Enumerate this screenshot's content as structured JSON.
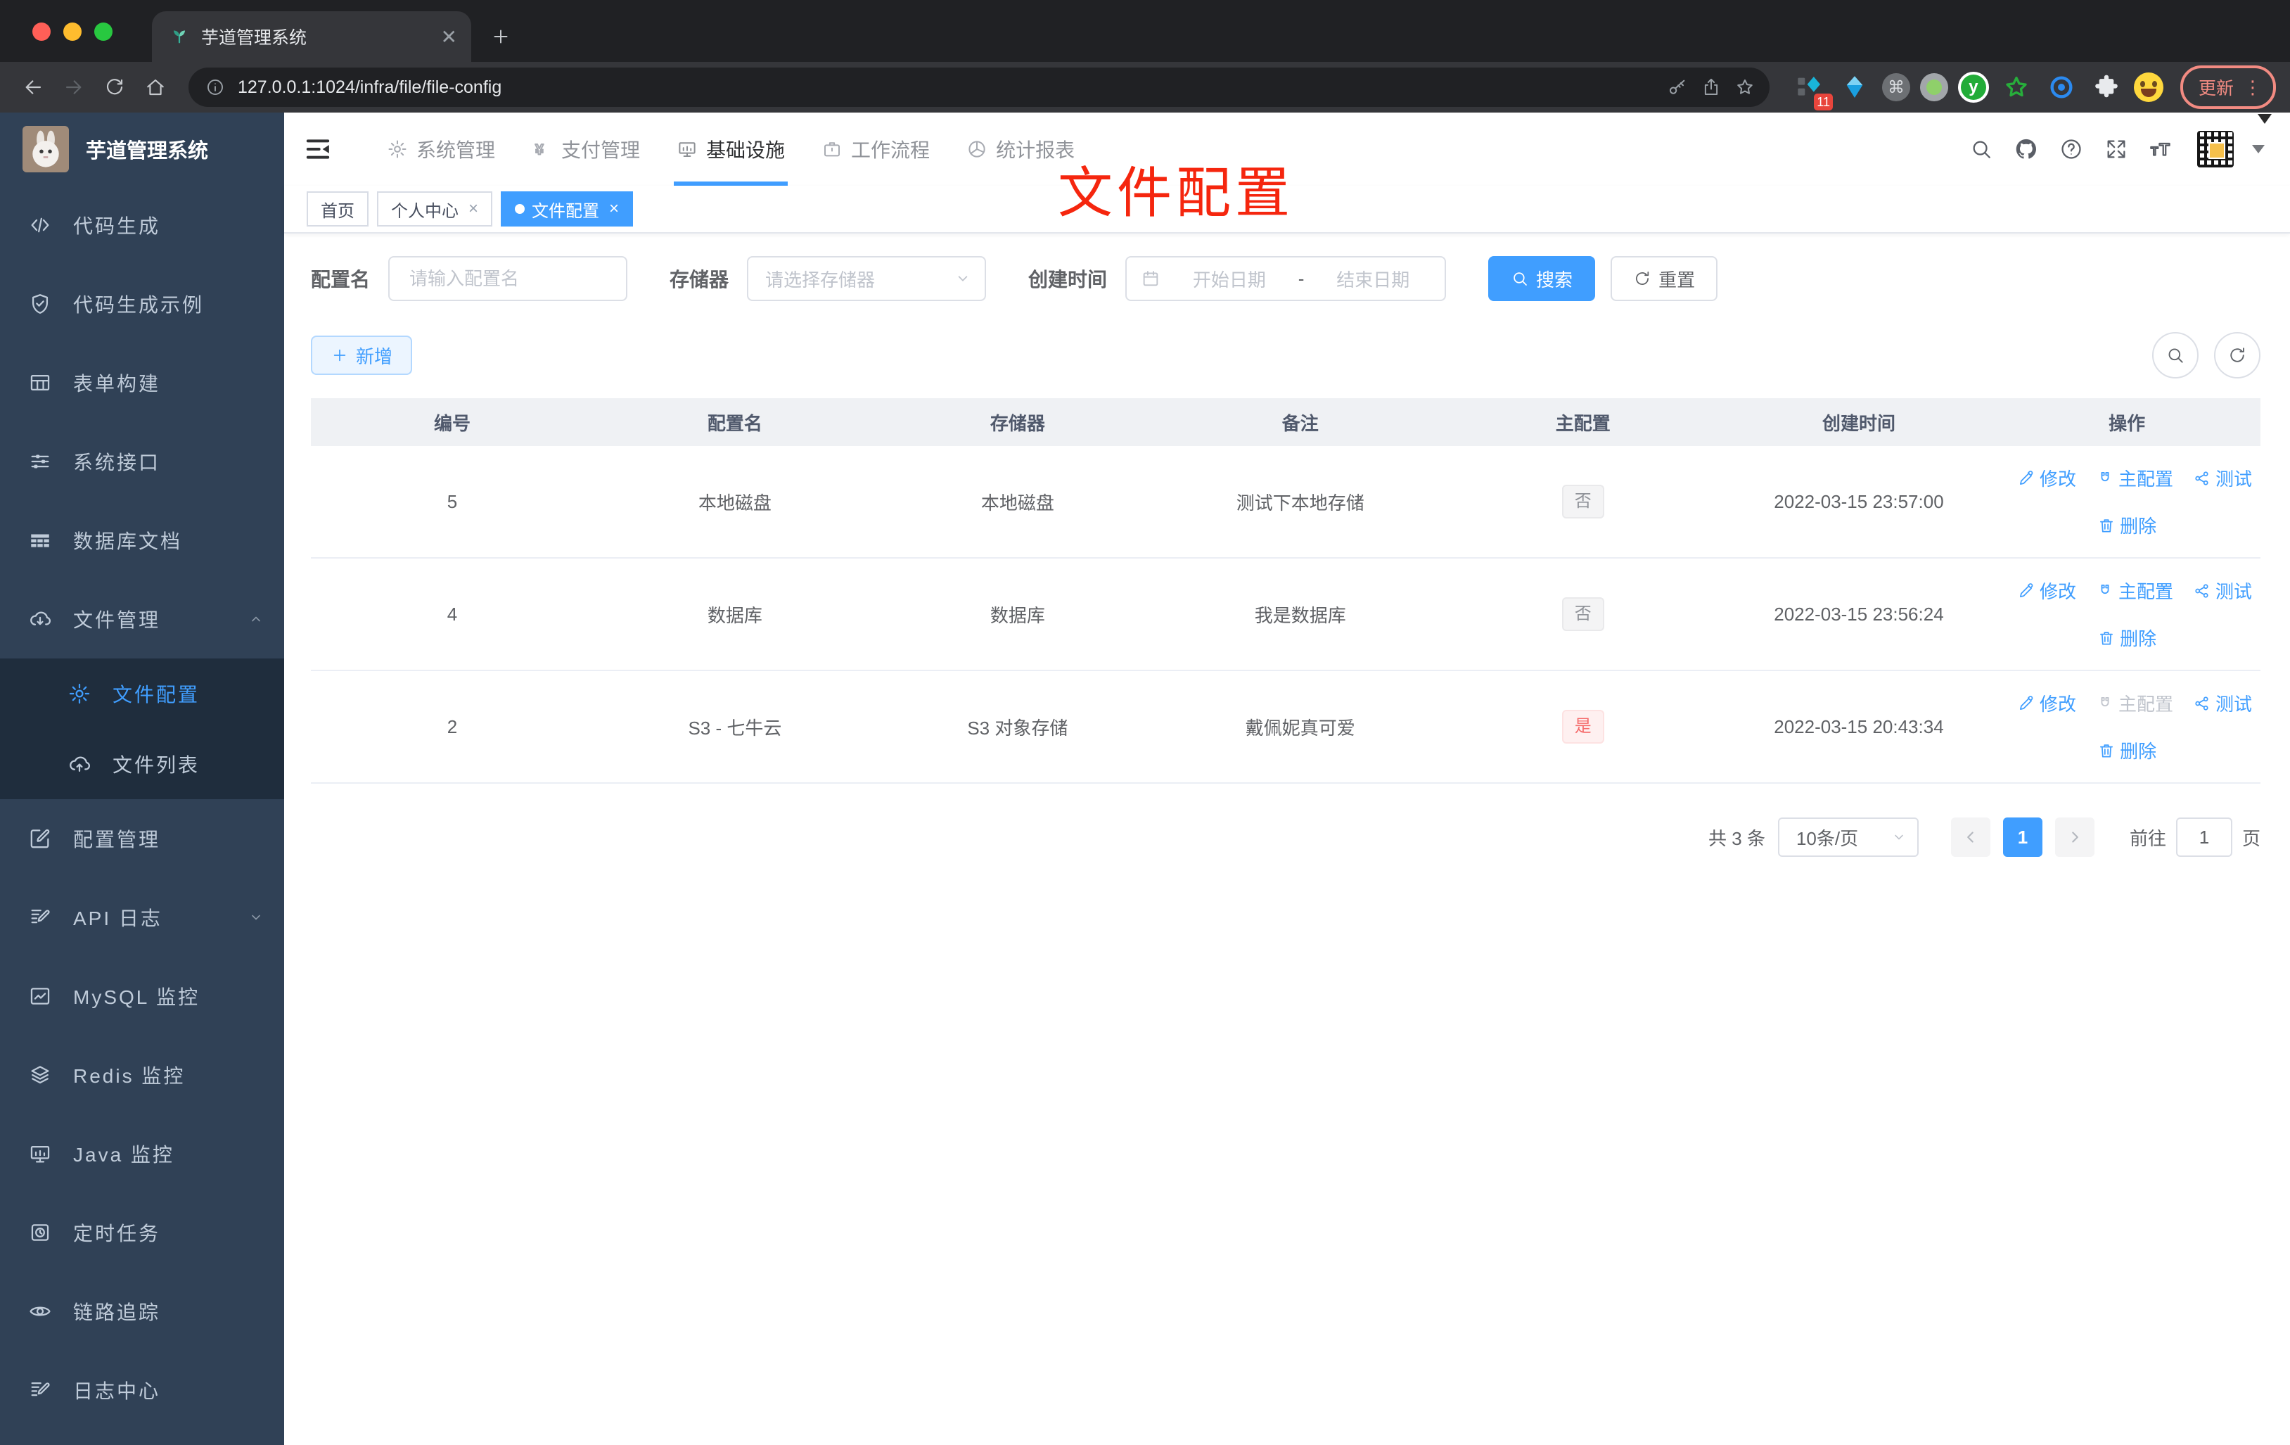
{
  "browser": {
    "tab_title": "芋道管理系统",
    "url": "127.0.0.1:1024/infra/file/file-config",
    "update_label": "更新",
    "extension_badge": "11"
  },
  "annotation": {
    "text": "文件配置"
  },
  "colors": {
    "primary": "#409eff",
    "danger": "#f56c6c",
    "annotation": "#f5260e",
    "sidebar_bg": "#304156",
    "submenu_bg": "#1f2d3d"
  },
  "sidebar": {
    "title": "芋道管理系统",
    "items": [
      {
        "key": "code-generation",
        "label": "代码生成",
        "icon": "code"
      },
      {
        "key": "code-example",
        "label": "代码生成示例",
        "icon": "shield"
      },
      {
        "key": "form-builder",
        "label": "表单构建",
        "icon": "form"
      },
      {
        "key": "system-api",
        "label": "系统接口",
        "icon": "sliders"
      },
      {
        "key": "db-doc",
        "label": "数据库文档",
        "icon": "tableS"
      },
      {
        "key": "file-manage",
        "label": "文件管理",
        "icon": "cloud-down",
        "chevron": "up"
      },
      {
        "key": "file-config",
        "label": "文件配置",
        "icon": "gear",
        "level": 2,
        "active": true
      },
      {
        "key": "file-list",
        "label": "文件列表",
        "icon": "cloud-up",
        "level": 2
      },
      {
        "key": "config-manage",
        "label": "配置管理",
        "icon": "edit"
      },
      {
        "key": "api-log",
        "label": "API 日志",
        "icon": "doc",
        "chevron": "down"
      },
      {
        "key": "mysql-monitor",
        "label": "MySQL 监控",
        "icon": "chart"
      },
      {
        "key": "redis-monitor",
        "label": "Redis 监控",
        "icon": "layers"
      },
      {
        "key": "java-monitor",
        "label": "Java 监控",
        "icon": "monitor"
      },
      {
        "key": "scheduled-task",
        "label": "定时任务",
        "icon": "clock"
      },
      {
        "key": "trace",
        "label": "链路追踪",
        "icon": "eye"
      },
      {
        "key": "log-center",
        "label": "日志中心",
        "icon": "doc"
      }
    ]
  },
  "topnav": {
    "items": [
      {
        "key": "system",
        "label": "系统管理",
        "icon": "gear"
      },
      {
        "key": "payment",
        "label": "支付管理",
        "icon": "yen"
      },
      {
        "key": "infra",
        "label": "基础设施",
        "icon": "monitor",
        "active": true
      },
      {
        "key": "workflow",
        "label": "工作流程",
        "icon": "briefcase"
      },
      {
        "key": "report",
        "label": "统计报表",
        "icon": "pie"
      }
    ]
  },
  "tags": {
    "items": [
      {
        "key": "home",
        "label": "首页"
      },
      {
        "key": "profile",
        "label": "个人中心",
        "closable": true
      },
      {
        "key": "file-config",
        "label": "文件配置",
        "closable": true,
        "active": true
      }
    ]
  },
  "filters": {
    "name_label": "配置名",
    "name_placeholder": "请输入配置名",
    "storage_label": "存储器",
    "storage_placeholder": "请选择存储器",
    "date_label": "创建时间",
    "date_start": "开始日期",
    "date_sep": "-",
    "date_end": "结束日期",
    "search_label": "搜索",
    "reset_label": "重置"
  },
  "toolbar": {
    "add_label": "新增"
  },
  "table": {
    "columns": [
      "编号",
      "配置名",
      "存储器",
      "备注",
      "主配置",
      "创建时间",
      "操作"
    ],
    "actions": {
      "edit": "修改",
      "master": "主配置",
      "test": "测试",
      "delete": "删除"
    },
    "rows": [
      {
        "id": "5",
        "name": "本地磁盘",
        "storage": "本地磁盘",
        "remark": "测试下本地存储",
        "master": "否",
        "master_type": "info",
        "created": "2022-03-15 23:57:00",
        "master_disabled": false
      },
      {
        "id": "4",
        "name": "数据库",
        "storage": "数据库",
        "remark": "我是数据库",
        "master": "否",
        "master_type": "info",
        "created": "2022-03-15 23:56:24",
        "master_disabled": false
      },
      {
        "id": "2",
        "name": "S3 - 七牛云",
        "storage": "S3 对象存储",
        "remark": "戴佩妮真可爱",
        "master": "是",
        "master_type": "danger",
        "created": "2022-03-15 20:43:34",
        "master_disabled": true
      }
    ]
  },
  "pagination": {
    "total": "共 3 条",
    "page_size": "10条/页",
    "current": "1",
    "goto_label": "前往",
    "goto_value": "1",
    "page_unit": "页"
  }
}
